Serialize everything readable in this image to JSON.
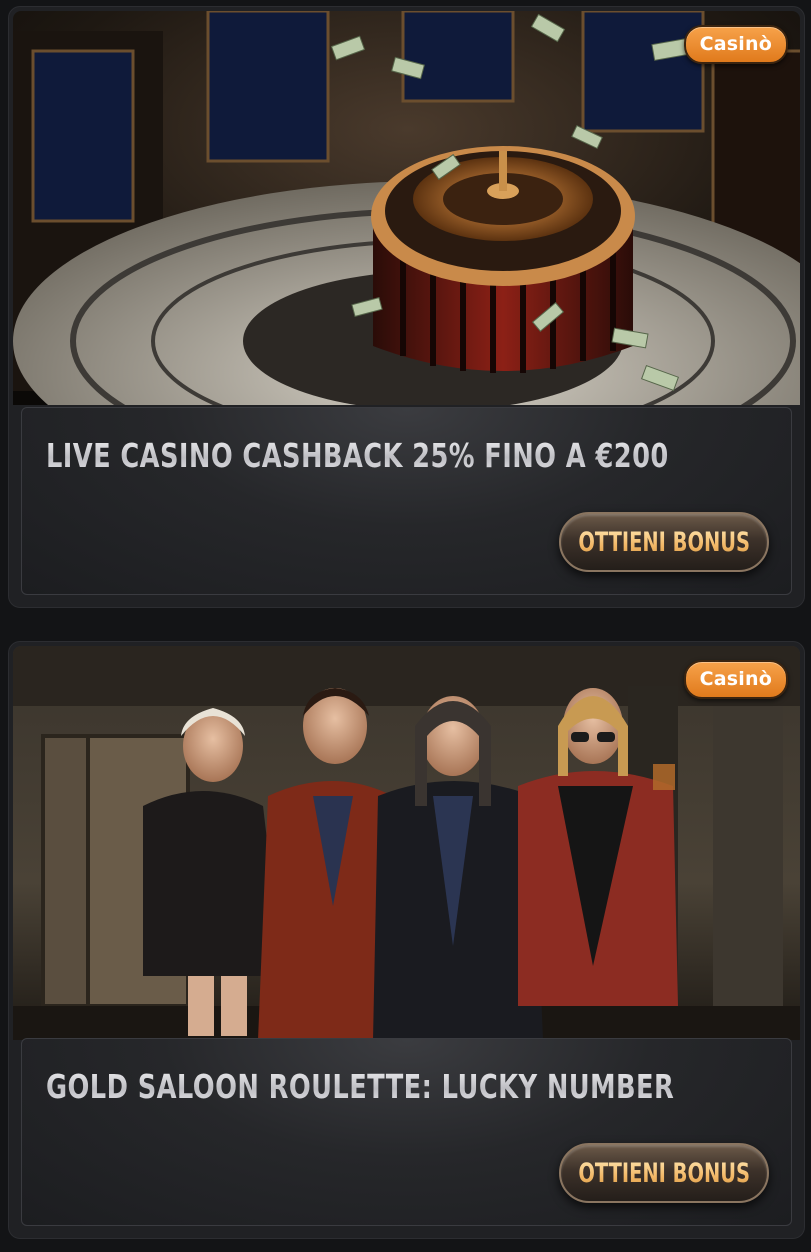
{
  "colors": {
    "page_background": "#131416",
    "card_background": "#202124",
    "badge_orange": "#f29436",
    "button_gold_text": "#f3c27a",
    "title_silver": "#d9d9dc"
  },
  "promos": [
    {
      "category": "Casinò",
      "title": "LIVE CASINO CASHBACK 25% FINO A €200",
      "button_label": "OTTIENI BONUS",
      "image_icon": "roulette-wheel-illustration"
    },
    {
      "category": "Casinò",
      "title": "GOLD SALOON ROULETTE: LUCKY NUMBER",
      "button_label": "OTTIENI BONUS",
      "image_icon": "gang-characters-illustration"
    }
  ]
}
